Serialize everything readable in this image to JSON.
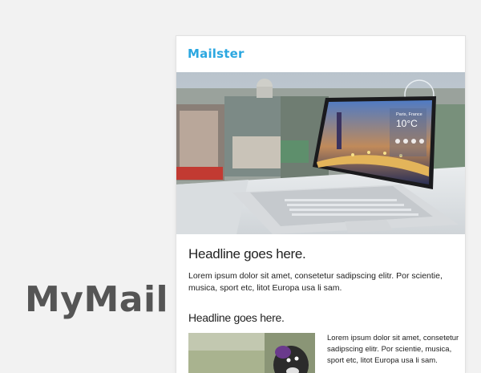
{
  "brand": {
    "wordmark": "MyMail"
  },
  "email": {
    "logo_text": "Mailster",
    "hero": {
      "screen_city": "Paris, France",
      "screen_temp": "10°C"
    },
    "headline_1": "Headline goes here.",
    "paragraph_1": "Lorem ipsum dolor sit amet, consetetur sadipscing elitr. Por scientie, musica, sport etc, litot Europa usa li sam.",
    "headline_2": "Headline goes here.",
    "article_text": "Lorem ipsum dolor sit amet, consetetur sadipscing elitr. Por scientie, musica, sport etc, litot Europa usa li sam."
  },
  "colors": {
    "page_background": "#f2f2f2",
    "logo_blue": "#2ba7e0",
    "wordmark_gray": "#555555"
  }
}
